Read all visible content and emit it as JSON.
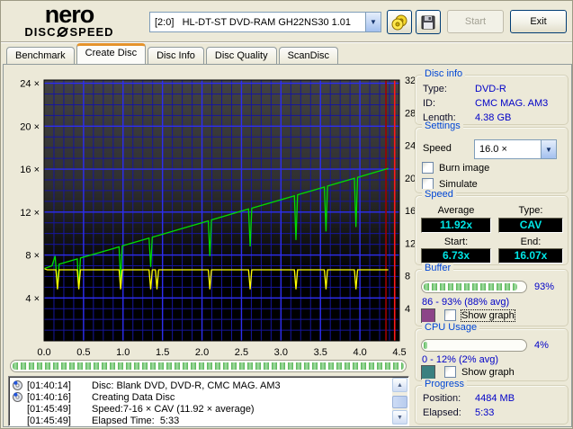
{
  "header": {
    "logo_line1": "nero",
    "logo_left": "DISC",
    "logo_right": "SPEED",
    "drive_select": {
      "value": "[2:0]   HL-DT-ST DVD-RAM GH22NS30 1.01"
    },
    "start_label": "Start",
    "exit_label": "Exit"
  },
  "tabs": {
    "items": [
      {
        "label": "Benchmark"
      },
      {
        "label": "Create Disc"
      },
      {
        "label": "Disc Info"
      },
      {
        "label": "Disc Quality"
      },
      {
        "label": "ScanDisc"
      }
    ]
  },
  "chart_data": {
    "type": "line",
    "xlim": [
      0,
      4.5
    ],
    "ylim_left": [
      0,
      24.3
    ],
    "ylim_right": [
      0,
      32
    ],
    "grid": {
      "minor_x": 0.125,
      "minor_y": 1,
      "major_x": 0.5,
      "major_y": 4,
      "minor_color": "#16169e",
      "major_color": "#2e2ef0"
    },
    "x_ticks": [
      "0.0",
      "0.5",
      "1.0",
      "1.5",
      "2.0",
      "2.5",
      "3.0",
      "3.5",
      "4.0",
      "4.5"
    ],
    "y_left_ticks": [
      {
        "value": 24,
        "label": "24 ×"
      },
      {
        "value": 20,
        "label": "20 ×"
      },
      {
        "value": 16,
        "label": "16 ×"
      },
      {
        "value": 12,
        "label": "12 ×"
      },
      {
        "value": 8,
        "label": "8 ×"
      },
      {
        "value": 4,
        "label": "4 ×"
      }
    ],
    "y_right_ticks": [
      {
        "value": 32,
        "label": "32"
      },
      {
        "value": 28,
        "label": "28"
      },
      {
        "value": 24,
        "label": "24"
      },
      {
        "value": 20,
        "label": "20"
      },
      {
        "value": 16,
        "label": "16"
      },
      {
        "value": 12,
        "label": "12"
      },
      {
        "value": 8,
        "label": "8"
      },
      {
        "value": 4,
        "label": "4"
      }
    ],
    "series": [
      {
        "name": "write-speed",
        "color": "#00dd00",
        "points": [
          [
            0,
            6.73
          ],
          [
            0.1,
            7.0
          ],
          [
            0.14,
            7.9
          ],
          [
            0.17,
            4.9
          ],
          [
            0.19,
            7.15
          ],
          [
            0.42,
            7.63
          ],
          [
            0.44,
            4.9
          ],
          [
            0.46,
            7.72
          ],
          [
            0.95,
            8.76
          ],
          [
            0.97,
            5.6
          ],
          [
            0.99,
            8.85
          ],
          [
            1.33,
            9.58
          ],
          [
            1.35,
            6.9
          ],
          [
            1.37,
            9.66
          ],
          [
            2.08,
            11.18
          ],
          [
            2.1,
            7.9
          ],
          [
            2.12,
            11.27
          ],
          [
            2.59,
            12.28
          ],
          [
            2.61,
            8.8
          ],
          [
            2.63,
            12.36
          ],
          [
            3.17,
            13.52
          ],
          [
            3.19,
            9.4
          ],
          [
            3.21,
            13.61
          ],
          [
            3.55,
            14.33
          ],
          [
            3.57,
            10.2
          ],
          [
            3.59,
            14.42
          ],
          [
            3.93,
            15.15
          ],
          [
            3.95,
            10.6
          ],
          [
            3.97,
            15.23
          ],
          [
            4.36,
            16.07
          ]
        ]
      },
      {
        "name": "requested-speed",
        "color": "#ffff00",
        "points": [
          [
            0,
            6.73
          ],
          [
            0.04,
            6.62
          ],
          [
            0.15,
            6.62
          ],
          [
            0.17,
            4.8
          ],
          [
            0.19,
            6.62
          ],
          [
            0.42,
            6.62
          ],
          [
            0.44,
            4.8
          ],
          [
            0.46,
            6.62
          ],
          [
            0.95,
            6.62
          ],
          [
            0.97,
            4.8
          ],
          [
            0.99,
            6.62
          ],
          [
            1.33,
            6.62
          ],
          [
            1.35,
            4.8
          ],
          [
            1.37,
            6.62
          ],
          [
            1.41,
            6.62
          ],
          [
            1.43,
            4.8
          ],
          [
            1.45,
            6.62
          ],
          [
            2.08,
            6.62
          ],
          [
            2.1,
            4.8
          ],
          [
            2.12,
            6.62
          ],
          [
            2.59,
            6.62
          ],
          [
            2.61,
            4.8
          ],
          [
            2.63,
            6.62
          ],
          [
            3.17,
            6.62
          ],
          [
            3.19,
            4.8
          ],
          [
            3.21,
            6.62
          ],
          [
            3.55,
            6.62
          ],
          [
            3.57,
            4.8
          ],
          [
            3.59,
            6.62
          ],
          [
            3.93,
            6.62
          ],
          [
            3.95,
            4.8
          ],
          [
            3.97,
            6.62
          ],
          [
            4.36,
            6.62
          ]
        ]
      }
    ],
    "markers": [
      {
        "type": "vline",
        "x": 4.33,
        "color": "#a00000"
      },
      {
        "type": "vline",
        "x": 4.44,
        "color": "#ff1a1a"
      }
    ]
  },
  "panels": {
    "disc_info": {
      "title": "Disc info",
      "rows": [
        {
          "label": "Type:",
          "value": "DVD-R"
        },
        {
          "label": "ID:",
          "value": "CMC MAG. AM3"
        },
        {
          "label": "Length:",
          "value": "4.38 GB"
        }
      ]
    },
    "settings": {
      "title": "Settings",
      "speed_label": "Speed",
      "speed_value": "16.0 ×",
      "burn_image_label": "Burn image",
      "simulate_label": "Simulate"
    },
    "speed": {
      "title": "Speed",
      "average_label": "Average",
      "average_value": "11.92x",
      "type_label": "Type:",
      "type_value": "CAV",
      "start_label": "Start:",
      "start_value": "6.73x",
      "end_label": "End:",
      "end_value": "16.07x"
    },
    "buffer": {
      "title": "Buffer",
      "percent": "93%",
      "value_pct": 93,
      "range": "86 - 93% (88% avg)",
      "show_graph_label": "Show graph",
      "swatch_color": "#8c4488"
    },
    "cpu": {
      "title": "CPU Usage",
      "percent": "4%",
      "value_pct": 4,
      "range": "0 - 12% (2% avg)",
      "show_graph_label": "Show graph",
      "swatch_color": "#3a8080"
    },
    "progress": {
      "title": "Progress",
      "position_label": "Position:",
      "position_value": "4484 MB",
      "elapsed_label": "Elapsed:",
      "elapsed_value": "5:33"
    }
  },
  "main_progress": {
    "value_pct": 100
  },
  "log": {
    "entries": [
      {
        "time": "[01:40:14]",
        "text": "Disc: Blank DVD, DVD-R, CMC MAG. AM3",
        "icon": true
      },
      {
        "time": "[01:40:16]",
        "text": "Creating Data Disc",
        "icon": true
      },
      {
        "time": "[01:45:49]",
        "text": "Speed:7-16 × CAV (11.92 × average)",
        "icon": false
      },
      {
        "time": "[01:45:49]",
        "text": "Elapsed Time:  5:33",
        "icon": false
      }
    ]
  }
}
